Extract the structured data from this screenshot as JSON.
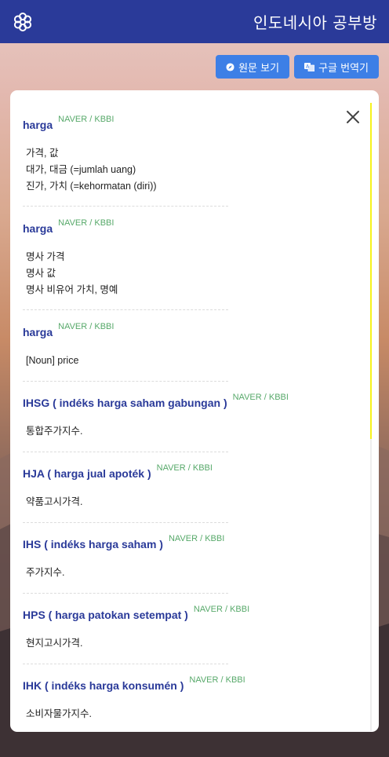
{
  "header": {
    "title": "인도네시아 공부방",
    "logo_icon": "flower-icon"
  },
  "actions": {
    "original_label": "원문 보기",
    "translate_label": "구글 번역기"
  },
  "entries": [
    {
      "word": "harga",
      "source": "NAVER / KBBI",
      "defs": [
        "가격, 값",
        "대가, 대금 (=jumlah uang)",
        "진가, 가치 (=kehormatan (diri))"
      ]
    },
    {
      "word": "harga",
      "source": "NAVER / KBBI",
      "defs": [
        "명사 가격",
        "명사 값",
        "명사 비유어 가치, 명예"
      ]
    },
    {
      "word": "harga",
      "source": "NAVER / KBBI",
      "defs": [
        "[Noun] price"
      ]
    },
    {
      "word": "IHSG ( indéks harga saham gabungan )",
      "source": "NAVER / KBBI",
      "defs": [
        "통합주가지수."
      ]
    },
    {
      "word": "HJA ( harga jual apoték )",
      "source": "NAVER / KBBI",
      "defs": [
        "약품고시가격."
      ]
    },
    {
      "word": "IHS ( indéks harga saham )",
      "source": "NAVER / KBBI",
      "defs": [
        "주가지수."
      ]
    },
    {
      "word": "HPS ( harga patokan setempat )",
      "source": "NAVER / KBBI",
      "defs": [
        "현지고시가격."
      ]
    },
    {
      "word": "IHK ( indéks harga konsumén )",
      "source": "NAVER / KBBI",
      "defs": [
        "소비자물가지수."
      ]
    }
  ]
}
